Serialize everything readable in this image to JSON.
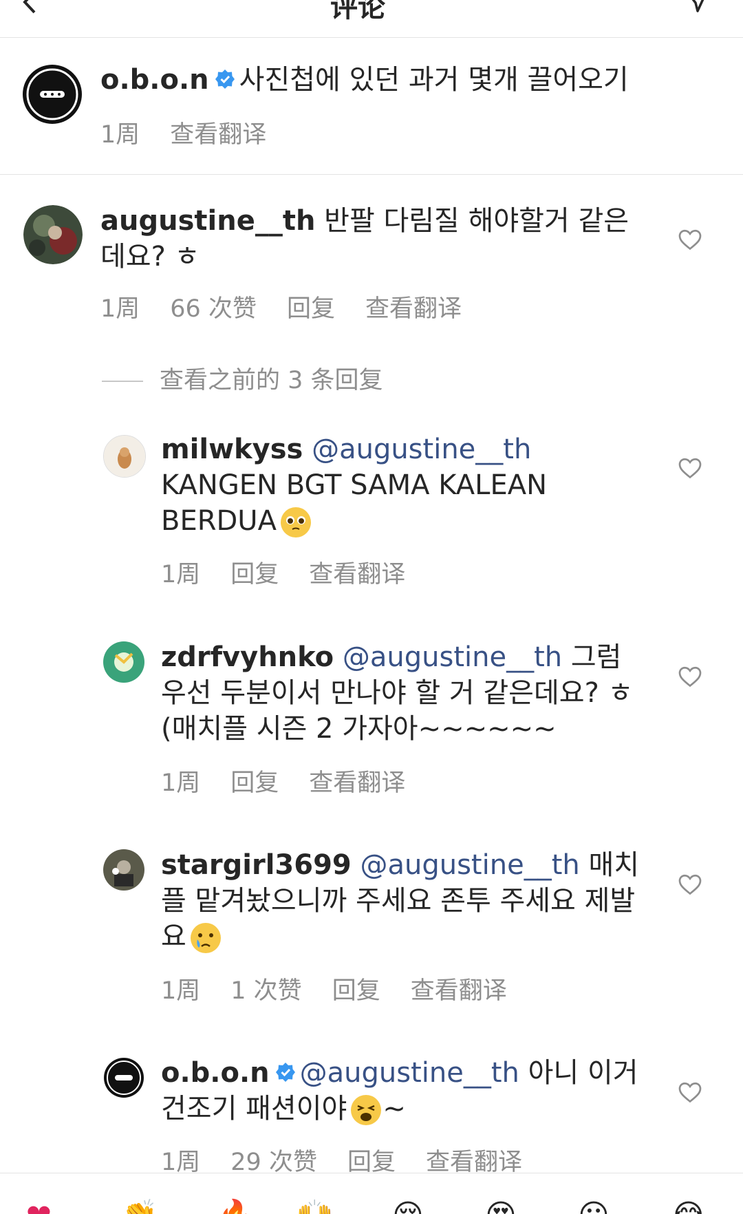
{
  "header": {
    "title": "评论"
  },
  "caption": {
    "username": "o.b.o.n",
    "text": "사진첩에 있던 과거 몇개 끌어오기",
    "time": "1周",
    "translate": "查看翻译"
  },
  "comment_main": {
    "username": "augustine__th",
    "text": "반팔 다림질 해야할거 같은데요? ㅎ",
    "time": "1周",
    "likes": "66 次赞",
    "reply": "回复",
    "translate": "查看翻译"
  },
  "view_previous": "查看之前的 3 条回复",
  "replies": [
    {
      "username": "milwkyss",
      "mention": "@augustine__th",
      "text": "KANGEN BGT SAMA KALEAN BERDUA",
      "emoji": "pleading-face",
      "time": "1周",
      "reply": "回复",
      "translate": "查看翻译"
    },
    {
      "username": "zdrfvyhnko",
      "mention": "@augustine__th",
      "text": "그럼 우선 두분이서 만나야 할 거 같은데요? ㅎ (매치플 시즌 2 가자아~~~~~~",
      "time": "1周",
      "reply": "回复",
      "translate": "查看翻译"
    },
    {
      "username": "stargirl3699",
      "mention": "@augustine__th",
      "text": "매치플 맡겨놨으니까 주세요 존투 주세요 제발요",
      "emoji": "crying-face",
      "time": "1周",
      "likes": "1 次赞",
      "reply": "回复",
      "translate": "查看翻译"
    },
    {
      "username": "o.b.o.n",
      "mention": "@augustine__th",
      "text": "아니 이거 건조기 패션이야",
      "emoji": "weary-face",
      "text_after": "~",
      "time": "1周",
      "likes": "29 次赞",
      "reply": "回复",
      "translate": "查看翻译"
    }
  ],
  "colors": {
    "text": "#262626",
    "secondary": "#8e8e8e",
    "mention": "#385185",
    "verified": "#3897f0"
  }
}
